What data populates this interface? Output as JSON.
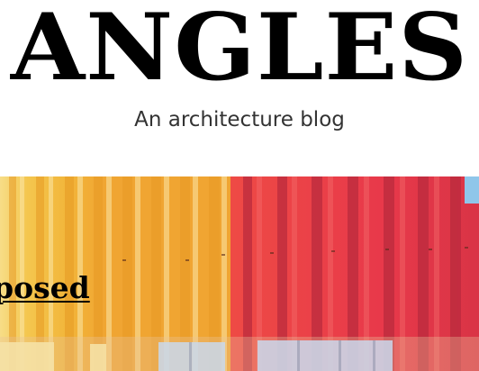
{
  "header": {
    "site_title": "ANGLES",
    "tagline": "An architecture blog"
  },
  "hero": {
    "post_title_visible": "posed",
    "image_colors": {
      "yellow": "#f2b53a",
      "orange": "#f2a235",
      "red": "#e8394a",
      "sky": "#8fc6ea"
    }
  }
}
